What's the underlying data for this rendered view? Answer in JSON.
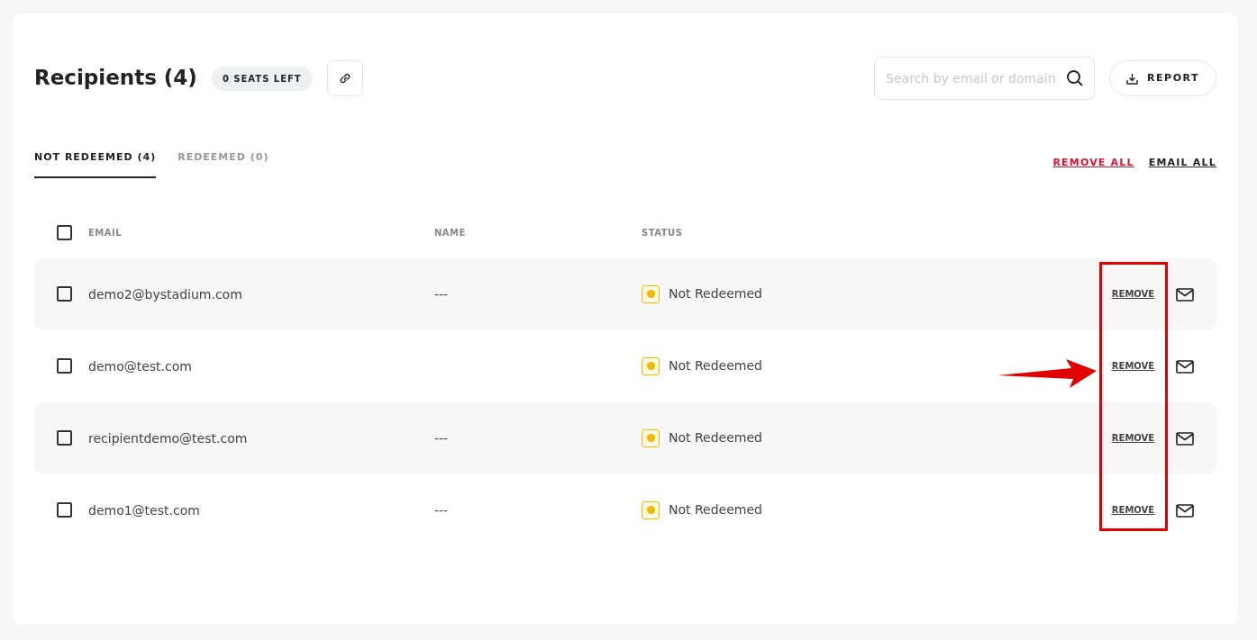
{
  "header": {
    "title": "Recipients (4)",
    "seats_badge": "0 SEATS LEFT"
  },
  "search": {
    "placeholder": "Search by email or domain"
  },
  "report_button": {
    "label": "REPORT"
  },
  "tabs": [
    {
      "label": "NOT REDEEMED (4)",
      "selected": true
    },
    {
      "label": "REDEEMED (0)",
      "selected": false
    }
  ],
  "bulk_actions": {
    "remove_all": "REMOVE ALL",
    "email_all": "EMAIL ALL"
  },
  "table": {
    "select_all_checked": false,
    "columns": [
      "EMAIL",
      "NAME",
      "STATUS"
    ],
    "rows": [
      {
        "checked": false,
        "email": "demo2@bystadium.com",
        "name": "---",
        "status": "Not Redeemed",
        "color": "#f5b800",
        "action": "REMOVE"
      },
      {
        "checked": false,
        "email": "demo@test.com",
        "status": "Not Redeemed",
        "color": "#f5b800",
        "action": "REMOVE"
      },
      {
        "checked": false,
        "email": "recipientdemo@test.com",
        "name": "---",
        "status": "Not Redeemed",
        "color": "#f5b800",
        "action": "REMOVE"
      },
      {
        "checked": false,
        "email": "demo1@test.com",
        "name": "---",
        "status": "Not Redeemed",
        "color": "#f5b800",
        "action": "REMOVE"
      }
    ]
  },
  "annotation": {
    "highlight_frame": true,
    "arrow": true
  }
}
